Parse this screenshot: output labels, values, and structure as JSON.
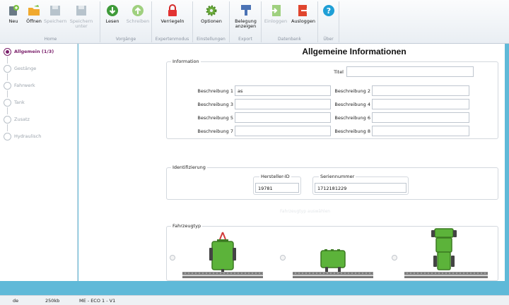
{
  "ribbon": {
    "groups": [
      {
        "label": "Home"
      },
      {
        "label": "Vorgänge"
      },
      {
        "label": "Expertenmodus"
      },
      {
        "label": "Einstellungen"
      },
      {
        "label": "Export"
      },
      {
        "label": "Datenbank"
      },
      {
        "label": "Über"
      }
    ],
    "buttons": {
      "new": "Neu",
      "open": "Öffnen",
      "save": "Speichern",
      "save_as": "Speichern unter",
      "read": "Lesen",
      "write": "Schreiben",
      "lock": "Verriegeln",
      "options": "Optionen",
      "assignment": "Belegung anzeigen",
      "login": "Einloggen",
      "logout": "Ausloggen"
    }
  },
  "sidebar": {
    "items": [
      {
        "label": "Allgemein (1/3)"
      },
      {
        "label": "Gestänge"
      },
      {
        "label": "Fahrwerk"
      },
      {
        "label": "Tank"
      },
      {
        "label": "Zusatz"
      },
      {
        "label": "Hydraulisch"
      }
    ]
  },
  "main": {
    "title": "Allgemeine Informationen",
    "information": {
      "legend": "Information",
      "titel_label": "Titel",
      "titel_value": "",
      "fields": [
        {
          "label": "Beschreibung 1",
          "value": "as"
        },
        {
          "label": "Beschreibung 2",
          "value": ""
        },
        {
          "label": "Beschreibung 3",
          "value": ""
        },
        {
          "label": "Beschreibung 4",
          "value": ""
        },
        {
          "label": "Beschreibung 5",
          "value": ""
        },
        {
          "label": "Beschreibung 6",
          "value": ""
        },
        {
          "label": "Beschreibung 7",
          "value": ""
        },
        {
          "label": "Beschreibung 8",
          "value": ""
        }
      ]
    },
    "identifizierung": {
      "legend": "Identifizierung",
      "hersteller_label": "Hersteller-ID",
      "hersteller_value": "19781",
      "serien_label": "Seriennummer",
      "serien_value": "1712181229"
    },
    "faint_hint": "Fahrzeugtyp auswählen",
    "fahrzeugtyp": {
      "legend": "Fahrzeugtyp"
    }
  },
  "statusbar": {
    "lang": "de",
    "size": "250kb",
    "version": "ME - ECO 1 - V1"
  },
  "colors": {
    "accent": "#7a1f6a",
    "vehicle_green": "#5cb33a",
    "background": "#5fb9d8"
  }
}
